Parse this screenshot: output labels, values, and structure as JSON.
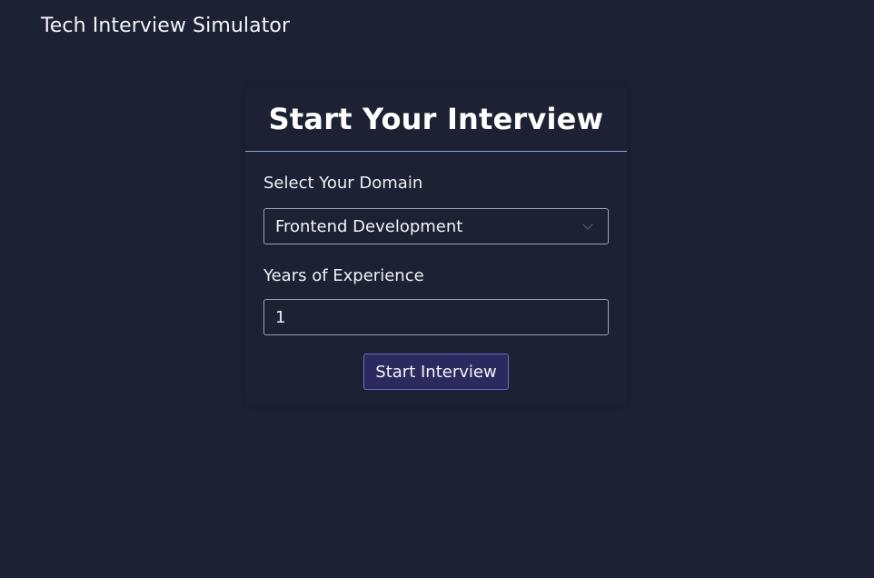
{
  "app": {
    "title": "Tech Interview Simulator"
  },
  "card": {
    "title": "Start Your Interview"
  },
  "form": {
    "domain_label": "Select Your Domain",
    "domain_value": "Frontend Development",
    "experience_label": "Years of Experience",
    "experience_value": "1",
    "submit_label": "Start Interview"
  },
  "icons": {
    "select_indicator": "chevron-down-icon"
  },
  "colors": {
    "background": "#1c2233",
    "button_bg": "#2b2a5e",
    "button_border": "#6b6bc4",
    "divider": "#8aa2c8",
    "input_border": "#9aa3b3"
  }
}
